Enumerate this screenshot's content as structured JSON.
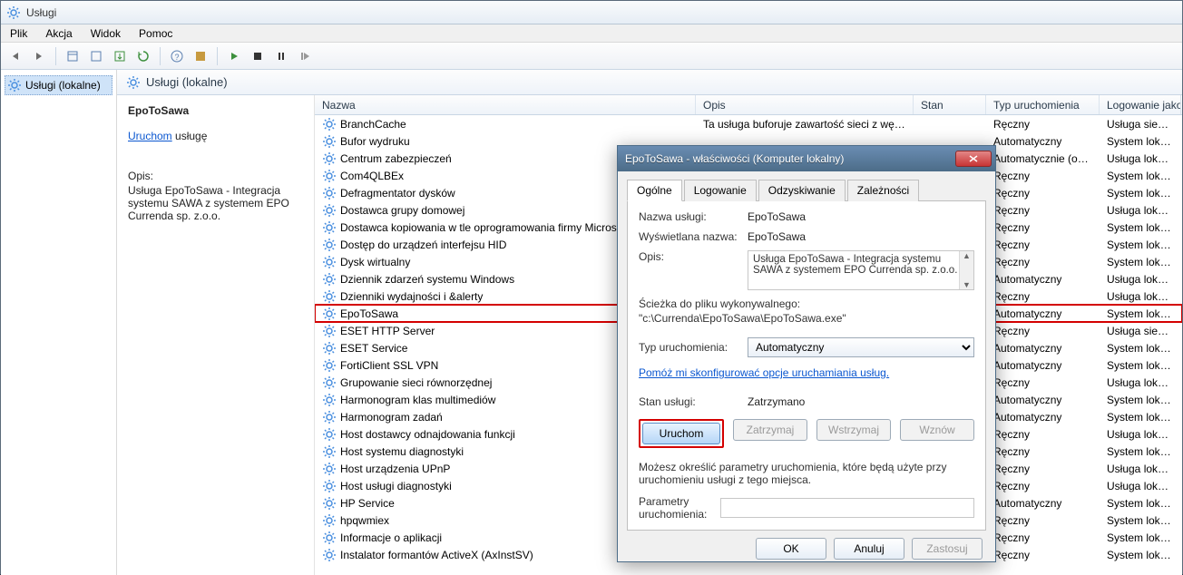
{
  "window": {
    "title": "Usługi"
  },
  "menu": {
    "items": [
      "Plik",
      "Akcja",
      "Widok",
      "Pomoc"
    ]
  },
  "tree": {
    "root": "Usługi (lokalne)"
  },
  "main_header": "Usługi (lokalne)",
  "detail": {
    "title": "EpoToSawa",
    "link_text": "Uruchom",
    "link_suffix": " usługę",
    "opis_label": "Opis:",
    "opis_text": "Usługa EpoToSawa - Integracja systemu SAWA z systemem EPO Currenda sp. z.o.o."
  },
  "columns": {
    "name": "Nazwa",
    "opis": "Opis",
    "stan": "Stan",
    "typ": "Typ uruchomienia",
    "log": "Logowanie jako"
  },
  "services": [
    {
      "name": "BranchCache",
      "opis": "Ta usługa buforuje zawartość sieci z węzł...",
      "stan": "",
      "typ": "Ręczny",
      "log": "Usługa sieciowa"
    },
    {
      "name": "Bufor wydruku",
      "opis": "",
      "stan": "",
      "typ": "Automatyczny",
      "log": "System lokalny"
    },
    {
      "name": "Centrum zabezpieczeń",
      "opis": "",
      "stan": "",
      "typ": "Automatycznie (op...",
      "log": "Usługa lokalna"
    },
    {
      "name": "Com4QLBEx",
      "opis": "",
      "stan": "",
      "typ": "Ręczny",
      "log": "System lokalny"
    },
    {
      "name": "Defragmentator dysków",
      "opis": "",
      "stan": "",
      "typ": "Ręczny",
      "log": "System lokalny"
    },
    {
      "name": "Dostawca grupy domowej",
      "opis": "",
      "stan": "",
      "typ": "Ręczny",
      "log": "Usługa lokalna"
    },
    {
      "name": "Dostawca kopiowania w tle oprogramowania firmy Microsof",
      "opis": "",
      "stan": "",
      "typ": "Ręczny",
      "log": "System lokalny"
    },
    {
      "name": "Dostęp do urządzeń interfejsu HID",
      "opis": "",
      "stan": "",
      "typ": "Ręczny",
      "log": "System lokalny"
    },
    {
      "name": "Dysk wirtualny",
      "opis": "",
      "stan": "",
      "typ": "Ręczny",
      "log": "System lokalny"
    },
    {
      "name": "Dziennik zdarzeń systemu Windows",
      "opis": "",
      "stan": "",
      "typ": "Automatyczny",
      "log": "Usługa lokalna"
    },
    {
      "name": "Dzienniki wydajności i &alerty",
      "opis": "",
      "stan": "",
      "typ": "Ręczny",
      "log": "Usługa lokalna"
    },
    {
      "name": "EpoToSawa",
      "opis": "",
      "stan": "",
      "typ": "Automatyczny",
      "log": "System lokalny",
      "highlighted": true
    },
    {
      "name": "ESET HTTP Server",
      "opis": "",
      "stan": "",
      "typ": "Ręczny",
      "log": "Usługa sieciowa"
    },
    {
      "name": "ESET Service",
      "opis": "",
      "stan": "",
      "typ": "Automatyczny",
      "log": "System lokalny"
    },
    {
      "name": "FortiClient SSL VPN",
      "opis": "",
      "stan": "",
      "typ": "Automatyczny",
      "log": "System lokalny"
    },
    {
      "name": "Grupowanie sieci równorzędnej",
      "opis": "",
      "stan": "",
      "typ": "Ręczny",
      "log": "Usługa lokalna"
    },
    {
      "name": "Harmonogram klas multimediów",
      "opis": "",
      "stan": "",
      "typ": "Automatyczny",
      "log": "System lokalny"
    },
    {
      "name": "Harmonogram zadań",
      "opis": "",
      "stan": "",
      "typ": "Automatyczny",
      "log": "System lokalny"
    },
    {
      "name": "Host dostawcy odnajdowania funkcji",
      "opis": "",
      "stan": "",
      "typ": "Ręczny",
      "log": "Usługa lokalna"
    },
    {
      "name": "Host systemu diagnostyki",
      "opis": "",
      "stan": "",
      "typ": "Ręczny",
      "log": "System lokalny"
    },
    {
      "name": "Host urządzenia UPnP",
      "opis": "",
      "stan": "",
      "typ": "Ręczny",
      "log": "Usługa lokalna"
    },
    {
      "name": "Host usługi diagnostyki",
      "opis": "",
      "stan": "",
      "typ": "Ręczny",
      "log": "Usługa lokalna"
    },
    {
      "name": "HP Service",
      "opis": "",
      "stan": "",
      "typ": "Automatyczny",
      "log": "System lokalny"
    },
    {
      "name": "hpqwmiex",
      "opis": "",
      "stan": "",
      "typ": "Ręczny",
      "log": "System lokalny"
    },
    {
      "name": "Informacje o aplikacji",
      "opis": "",
      "stan": "",
      "typ": "Ręczny",
      "log": "System lokalny"
    },
    {
      "name": "Instalator formantów ActiveX (AxInstSV)",
      "opis": "",
      "stan": "",
      "typ": "Ręczny",
      "log": "System lokalny"
    }
  ],
  "dialog": {
    "title": "EpoToSawa - właściwości (Komputer lokalny)",
    "tabs": [
      "Ogólne",
      "Logowanie",
      "Odzyskiwanie",
      "Zależności"
    ],
    "labels": {
      "service_name": "Nazwa usługi:",
      "display_name": "Wyświetlana nazwa:",
      "description": "Opis:",
      "exe_path": "Ścieżka do pliku wykonywalnego:",
      "startup_type": "Typ uruchomienia:",
      "config_link": "Pomóż mi skonfigurować opcje uruchamiania usług.",
      "service_state": "Stan usługi:",
      "hint": "Możesz określić parametry uruchomienia, które będą użyte przy uruchomieniu usługi z tego miejsca.",
      "params": "Parametry uruchomienia:"
    },
    "values": {
      "service_name": "EpoToSawa",
      "display_name": "EpoToSawa",
      "description": "Usługa EpoToSawa - Integracja systemu SAWA z systemem EPO Currenda sp. z.o.o.",
      "exe_path": "\"c:\\Currenda\\EpoToSawa\\EpoToSawa.exe\"",
      "startup_type": "Automatyczny",
      "service_state": "Zatrzymano",
      "params": ""
    },
    "buttons": {
      "start": "Uruchom",
      "stop": "Zatrzymaj",
      "pause": "Wstrzymaj",
      "resume": "Wznów",
      "ok": "OK",
      "cancel": "Anuluj",
      "apply": "Zastosuj"
    }
  }
}
